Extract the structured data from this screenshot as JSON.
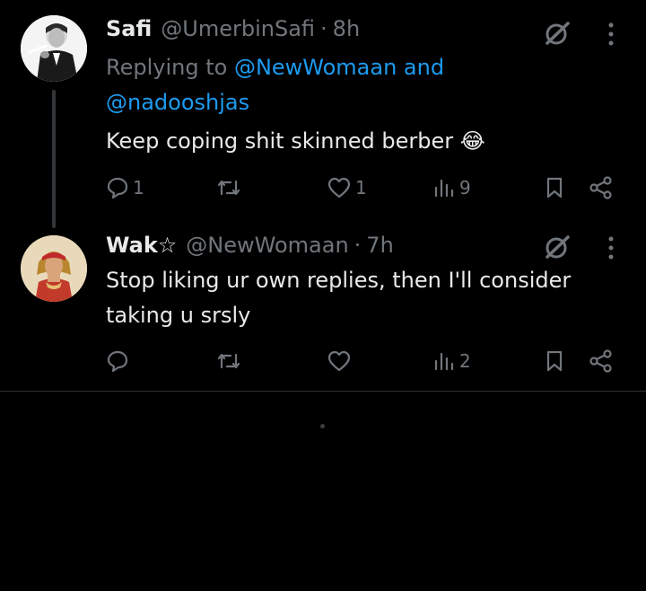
{
  "posts": [
    {
      "name": "Safi",
      "handle": "@UmerbinSafi",
      "separator": "·",
      "time": "8h",
      "replying_prefix": "Replying to ",
      "replying_user1": "@NewWomaan",
      "replying_and": " and",
      "replying_user2": "@nadooshjas",
      "text": "Keep coping shit skinned berber 😂",
      "replies": "1",
      "reposts": "",
      "likes": "1",
      "views": "9"
    },
    {
      "name": "Wak☆",
      "handle": "@NewWomaan",
      "separator": "·",
      "time": "7h",
      "text": "Stop liking ur own replies, then I'll consider taking u srsly",
      "replies": "",
      "reposts": "",
      "likes": "",
      "views": "2"
    }
  ],
  "icons": {
    "grok": "grok-icon",
    "more": "more-dots-icon",
    "reply": "reply-bubble-icon",
    "repost": "repost-icon",
    "like": "heart-icon",
    "views": "views-bar-icon",
    "bookmark": "bookmark-icon",
    "share": "share-icon"
  },
  "colors": {
    "background": "#000000",
    "text": "#e7e9ea",
    "muted": "#71767b",
    "link": "#1d9bf0",
    "divider": "#2f3336"
  }
}
